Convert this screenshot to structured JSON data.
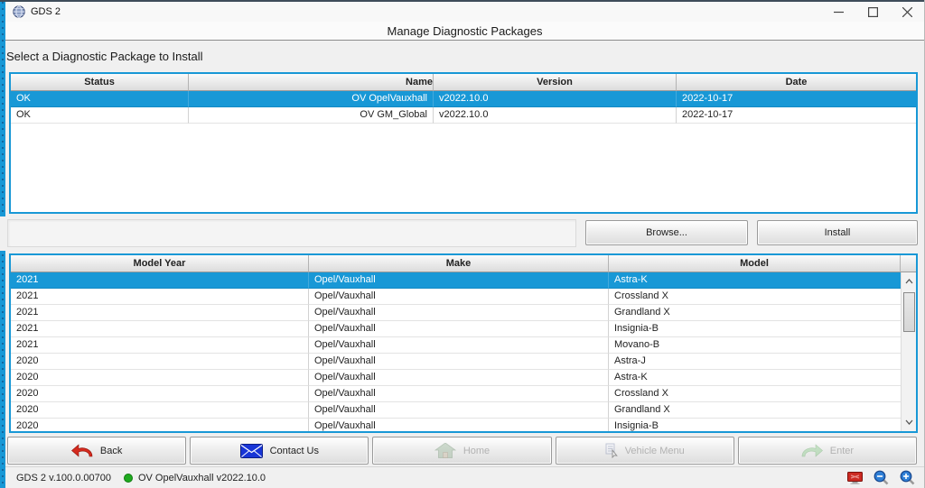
{
  "titlebar": {
    "title": "GDS 2"
  },
  "header": {
    "title": "Manage Diagnostic Packages"
  },
  "instruction_label": "Select a Diagnostic Package to Install",
  "packages_table": {
    "columns": [
      "Status",
      "Name",
      "Version",
      "Date"
    ],
    "rows": [
      {
        "status": "OK",
        "name": "OV OpelVauxhall",
        "version": "v2022.10.0",
        "date": "2022-10-17",
        "selected": true
      },
      {
        "status": "OK",
        "name": "OV GM_Global",
        "version": "v2022.10.0",
        "date": "2022-10-17",
        "selected": false
      }
    ]
  },
  "actions": {
    "browse_label": "Browse...",
    "install_label": "Install"
  },
  "vehicles_table": {
    "columns": [
      "Model Year",
      "Make",
      "Model"
    ],
    "rows": [
      {
        "year": "2021",
        "make": "Opel/Vauxhall",
        "model": "Astra-K",
        "selected": true
      },
      {
        "year": "2021",
        "make": "Opel/Vauxhall",
        "model": "Crossland X",
        "selected": false
      },
      {
        "year": "2021",
        "make": "Opel/Vauxhall",
        "model": "Grandland X",
        "selected": false
      },
      {
        "year": "2021",
        "make": "Opel/Vauxhall",
        "model": "Insignia-B",
        "selected": false
      },
      {
        "year": "2021",
        "make": "Opel/Vauxhall",
        "model": "Movano-B",
        "selected": false
      },
      {
        "year": "2020",
        "make": "Opel/Vauxhall",
        "model": "Astra-J",
        "selected": false
      },
      {
        "year": "2020",
        "make": "Opel/Vauxhall",
        "model": "Astra-K",
        "selected": false
      },
      {
        "year": "2020",
        "make": "Opel/Vauxhall",
        "model": "Crossland X",
        "selected": false
      },
      {
        "year": "2020",
        "make": "Opel/Vauxhall",
        "model": "Grandland X",
        "selected": false
      },
      {
        "year": "2020",
        "make": "Opel/Vauxhall",
        "model": "Insignia-B",
        "selected": false
      }
    ]
  },
  "toolbar": {
    "buttons": [
      {
        "label": "Back",
        "icon": "back-arrow-icon",
        "enabled": true
      },
      {
        "label": "Contact Us",
        "icon": "envelope-icon",
        "enabled": true
      },
      {
        "label": "Home",
        "icon": "home-icon",
        "enabled": false
      },
      {
        "label": "Vehicle Menu",
        "icon": "vehicle-menu-icon",
        "enabled": false
      },
      {
        "label": "Enter",
        "icon": "enter-arrow-icon",
        "enabled": false
      }
    ]
  },
  "statusbar": {
    "app_version": "GDS 2 v.100.0.00700",
    "active_package": "OV OpelVauxhall v2022.10.0",
    "status_icons": [
      "screen-icon",
      "zoom-out-icon",
      "zoom-in-icon"
    ]
  },
  "colors": {
    "selection_blue": "#1898d6",
    "table_border_blue": "#1898d6",
    "status_dot_green": "#1faa1f",
    "back_arrow_red": "#d42a1e",
    "envelope_blue": "#1835d6",
    "enter_arrow_green": "#8fce8f"
  }
}
